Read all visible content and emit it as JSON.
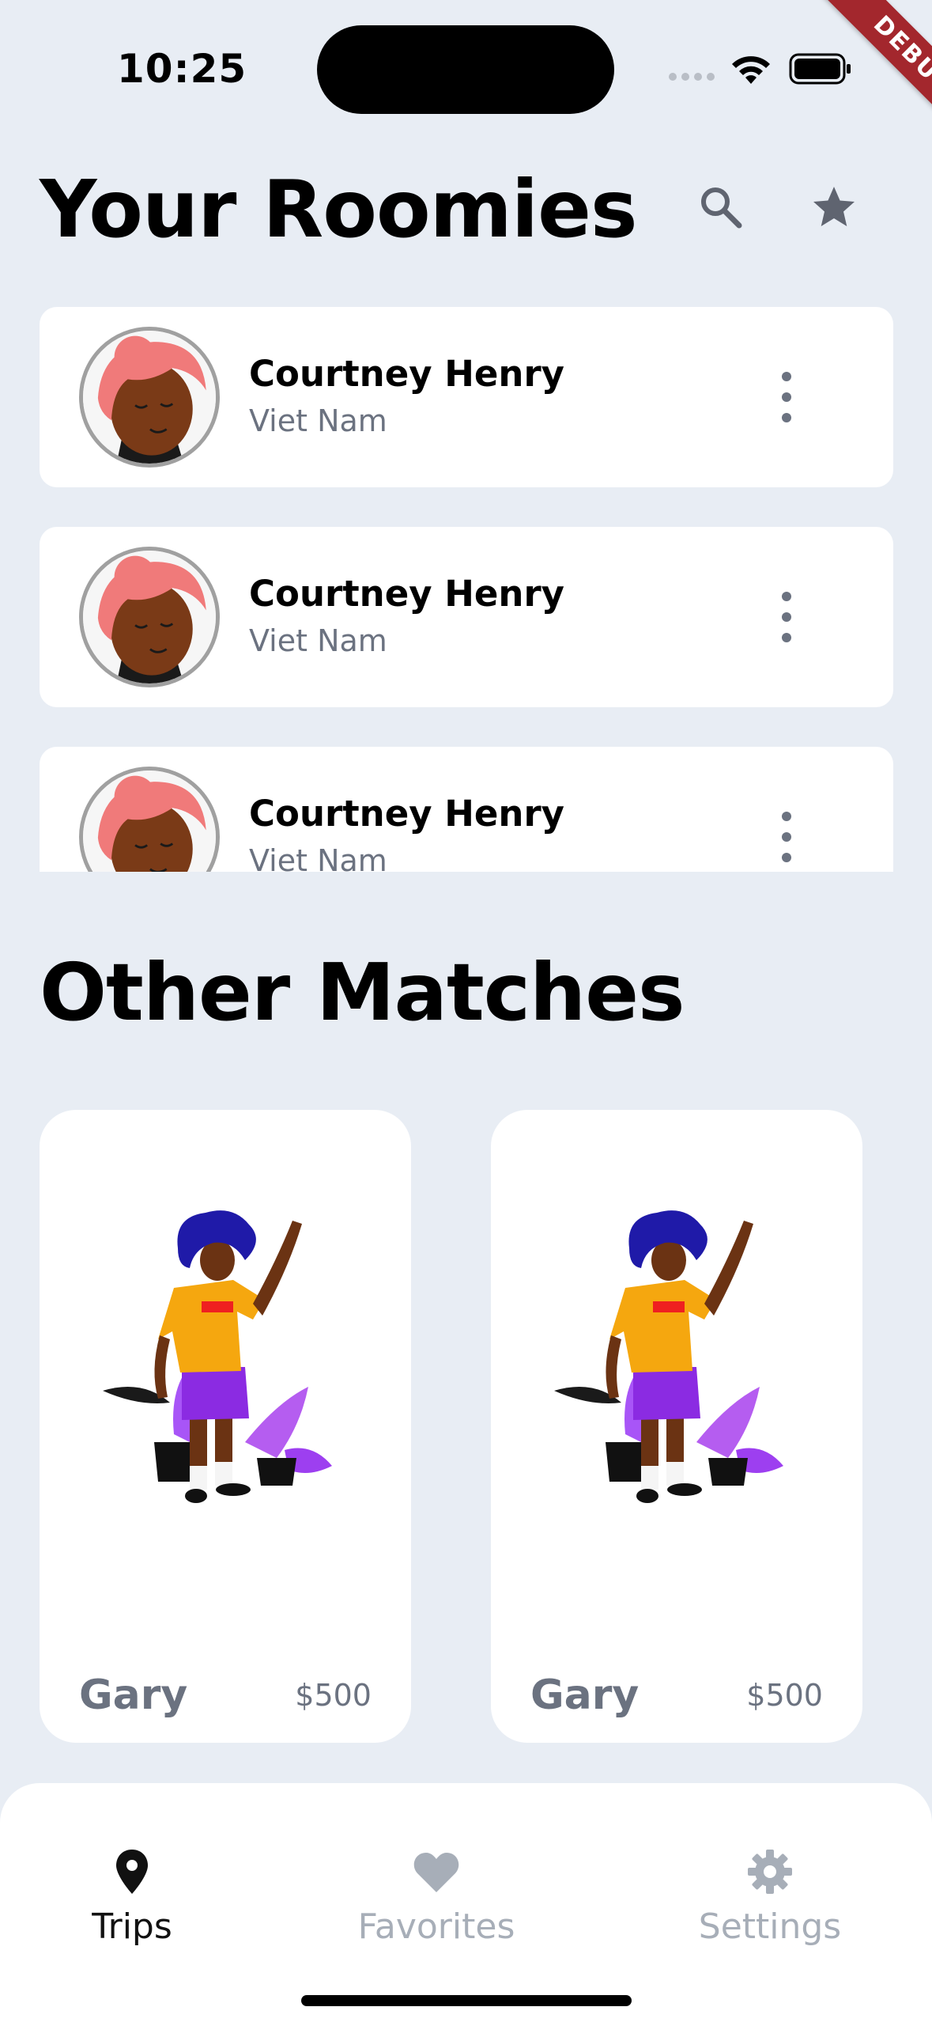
{
  "status_bar": {
    "time": "10:25"
  },
  "debug_banner": "DEBUG",
  "header": {
    "title": "Your Roomies",
    "search_icon": "search-icon",
    "star_icon": "star-icon"
  },
  "roomies": [
    {
      "name": "Courtney Henry",
      "location": "Viet Nam"
    },
    {
      "name": "Courtney Henry",
      "location": "Viet Nam"
    },
    {
      "name": "Courtney Henry",
      "location": "Viet Nam"
    }
  ],
  "other_matches": {
    "title": "Other Matches",
    "items": [
      {
        "name": "Gary",
        "price": "$500"
      },
      {
        "name": "Gary",
        "price": "$500"
      }
    ]
  },
  "bottom_nav": {
    "items": [
      {
        "label": "Trips",
        "icon": "map-pin-icon",
        "active": true
      },
      {
        "label": "Favorites",
        "icon": "heart-icon",
        "active": false
      },
      {
        "label": "Settings",
        "icon": "gear-icon",
        "active": false
      }
    ]
  },
  "colors": {
    "background": "#e8edf4",
    "card": "#ffffff",
    "secondary_text": "#6b7280",
    "inactive_nav": "#a7aeb8",
    "debug_ribbon": "#a3272d"
  }
}
